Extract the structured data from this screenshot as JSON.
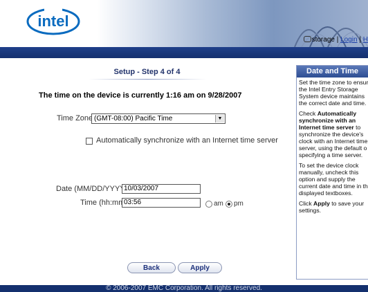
{
  "header": {
    "logo": "intel",
    "storage_label": "storage",
    "separator": "|",
    "login_link": "Login",
    "help_link": "H"
  },
  "main": {
    "step_title": "Setup - Step 4 of 4",
    "device_time_text": "The time on the device is currently 1:16 am on 9/28/2007",
    "timezone_label": "Time Zone:",
    "timezone_value": "(GMT-08:00) Pacific Time",
    "auto_sync_label": "Automatically synchronize with an Internet time server",
    "auto_sync_checked": false,
    "date_label": "Date (MM/DD/YYYY):",
    "date_value": "10/03/2007",
    "time_label": "Time (hh:mm):",
    "time_value": "03:56",
    "am_label": "am",
    "pm_label": "pm",
    "selected_period": "pm",
    "back_label": "Back",
    "apply_label": "Apply"
  },
  "side": {
    "title": "Date and Time",
    "p1_lines": [
      "Set the time zone to ensur",
      "the Intel Entry Storage",
      "System device maintains",
      "the correct date and time."
    ],
    "p2_pre": "Check ",
    "p2_bold_lines": [
      "Automatically",
      "synchronize with an",
      "Internet time server"
    ],
    "p2_post": " to",
    "p2_lines": [
      "synchronize the device's",
      "clock with an Internet time",
      "server, using the default o",
      "specifying a time server."
    ],
    "p3_lines": [
      "To set the device clock",
      "manually, uncheck this",
      "option and supply the",
      "current date and time in th",
      "displayed textboxes."
    ],
    "p4_pre": "Click ",
    "p4_bold": "Apply",
    "p4_post": " to save your",
    "p4_line2": "settings."
  },
  "footer": {
    "copyright": "© 2006-2007 EMC Corporation. All rights reserved."
  },
  "colors": {
    "nav_bar": "#14306e",
    "title_blue": "#22336b",
    "link_blue": "#1b3fa8",
    "logo_blue": "#0a6bbf"
  }
}
